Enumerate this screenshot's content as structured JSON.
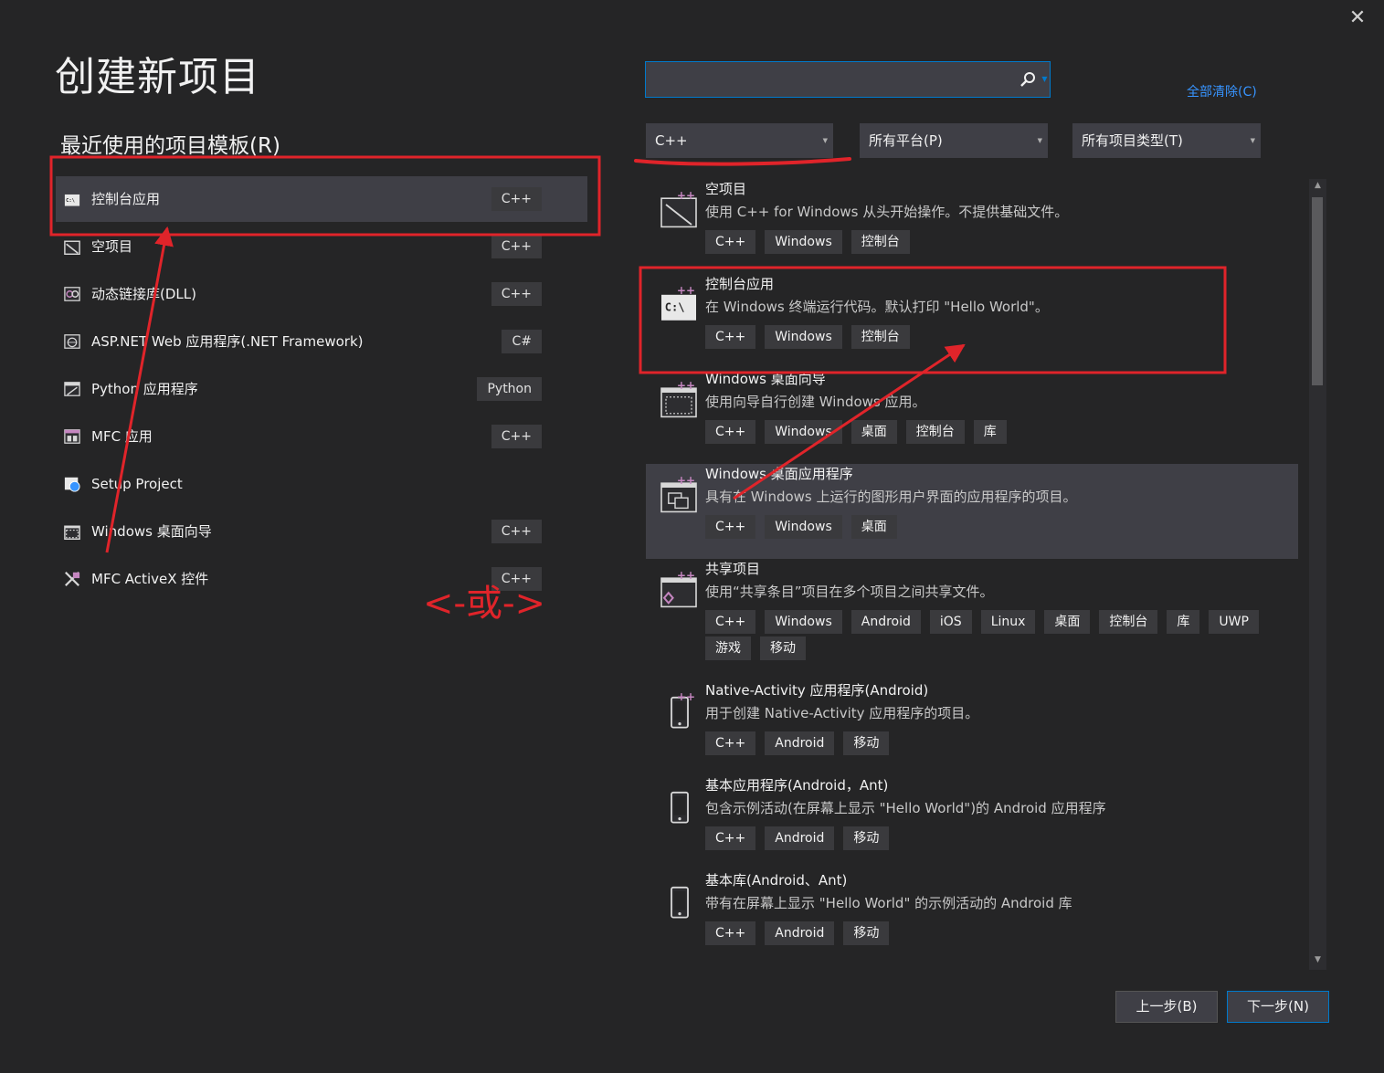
{
  "header": {
    "title": "创建新项目",
    "close_glyph": "✕"
  },
  "recent": {
    "title": "最近使用的项目模板(R)",
    "items": [
      {
        "name": "控制台应用",
        "lang": "C++",
        "icon": "console-app-icon"
      },
      {
        "name": "空项目",
        "lang": "C++",
        "icon": "empty-project-icon"
      },
      {
        "name": "动态链接库(DLL)",
        "lang": "C++",
        "icon": "dll-icon"
      },
      {
        "name": "ASP.NET Web 应用程序(.NET Framework)",
        "lang": "C#",
        "icon": "web-app-icon"
      },
      {
        "name": "Python 应用程序",
        "lang": "Python",
        "icon": "python-app-icon"
      },
      {
        "name": "MFC 应用",
        "lang": "C++",
        "icon": "mfc-app-icon"
      },
      {
        "name": "Setup Project",
        "lang": "",
        "icon": "setup-project-icon"
      },
      {
        "name": "Windows 桌面向导",
        "lang": "C++",
        "icon": "desktop-wizard-icon"
      },
      {
        "name": "MFC ActiveX 控件",
        "lang": "C++",
        "icon": "activex-icon"
      }
    ]
  },
  "search": {
    "value": "",
    "placeholder": ""
  },
  "clear_all": "全部清除(C)",
  "filters": {
    "language": "C++",
    "platform": "所有平台(P)",
    "project_type": "所有项目类型(T)"
  },
  "templates": [
    {
      "name": "空项目",
      "desc": "使用 C++ for Windows 从头开始操作。不提供基础文件。",
      "tags": [
        "C++",
        "Windows",
        "控制台"
      ],
      "icon": "empty-project-icon"
    },
    {
      "name": "控制台应用",
      "desc": "在 Windows 终端运行代码。默认打印 \"Hello World\"。",
      "tags": [
        "C++",
        "Windows",
        "控制台"
      ],
      "icon": "console-app-icon"
    },
    {
      "name": "Windows 桌面向导",
      "desc": "使用向导自行创建 Windows 应用。",
      "tags": [
        "C++",
        "Windows",
        "桌面",
        "控制台",
        "库"
      ],
      "icon": "desktop-wizard-icon"
    },
    {
      "name": "Windows 桌面应用程序",
      "desc": "具有在 Windows 上运行的图形用户界面的应用程序的项目。",
      "tags": [
        "C++",
        "Windows",
        "桌面"
      ],
      "icon": "desktop-app-icon"
    },
    {
      "name": "共享项目",
      "desc": "使用“共享条目”项目在多个项目之间共享文件。",
      "tags": [
        "C++",
        "Windows",
        "Android",
        "iOS",
        "Linux",
        "桌面",
        "控制台",
        "库",
        "UWP",
        "游戏",
        "移动"
      ],
      "icon": "shared-project-icon"
    },
    {
      "name": "Native-Activity 应用程序(Android)",
      "desc": "用于创建 Native-Activity 应用程序的项目。",
      "tags": [
        "C++",
        "Android",
        "移动"
      ],
      "icon": "android-native-icon"
    },
    {
      "name": "基本应用程序(Android，Ant)",
      "desc": "包含示例活动(在屏幕上显示 \"Hello World\")的 Android 应用程序",
      "tags": [
        "C++",
        "Android",
        "移动"
      ],
      "icon": "android-app-icon"
    },
    {
      "name": "基本库(Android、Ant)",
      "desc": "带有在屏幕上显示 \"Hello World\" 的示例活动的 Android 库",
      "tags": [
        "C++",
        "Android",
        "移动"
      ],
      "icon": "android-lib-icon"
    }
  ],
  "buttons": {
    "back": "上一步(B)",
    "next": "下一步(N)"
  },
  "annotation": {
    "or_label": "<-或->"
  },
  "colors": {
    "accent": "#007acc",
    "link": "#3794ff",
    "annotation_red": "#e0242a",
    "background": "#252526"
  }
}
